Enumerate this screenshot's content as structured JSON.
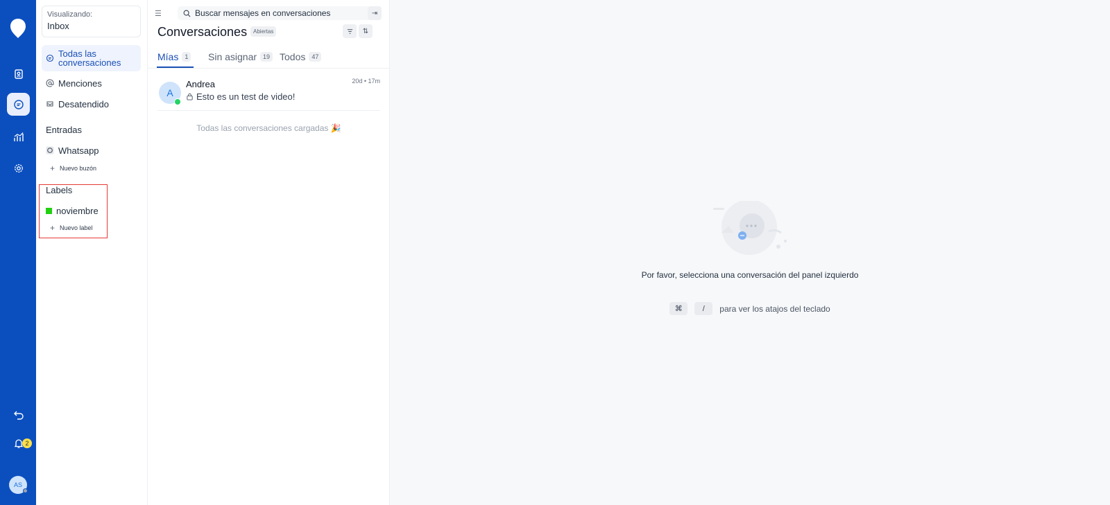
{
  "rail": {
    "nav_items": [
      "contacts",
      "conversations",
      "reports",
      "settings"
    ],
    "notifications_count": "2",
    "user_initials": "AS"
  },
  "sidebar": {
    "viewing_label": "Visualizando:",
    "viewing_value": "Inbox",
    "items": [
      {
        "label": "Todas las conversaciones",
        "icon": "chat-icon",
        "active": true
      },
      {
        "label": "Menciones",
        "icon": "at-icon"
      },
      {
        "label": "Desatendido",
        "icon": "unattended-icon"
      }
    ],
    "inboxes_title": "Entradas",
    "inboxes": [
      {
        "label": "Whatsapp",
        "icon": "whatsapp-icon"
      }
    ],
    "new_inbox": "Nuevo buzón",
    "labels_title": "Labels",
    "labels": [
      {
        "label": "noviembre",
        "color": "#22d011"
      }
    ],
    "new_label": "Nuevo label"
  },
  "list": {
    "search_placeholder": "Buscar mensajes en conversaciones",
    "title": "Conversaciones",
    "status": "Abiertas",
    "tabs": [
      {
        "label": "Mías",
        "count": "1",
        "active": true
      },
      {
        "label": "Sin asignar",
        "count": "19"
      },
      {
        "label": "Todos",
        "count": "47"
      }
    ],
    "conversations": [
      {
        "initial": "A",
        "name": "Andrea",
        "time": "20d • 17m",
        "message": "Esto es un test de video!"
      }
    ],
    "loaded_text": "Todas las conversaciones cargadas 🎉"
  },
  "detail": {
    "empty_message": "Por favor, selecciona una conversación del panel izquierdo",
    "shortcut_keys": [
      "⌘",
      "/"
    ],
    "shortcut_text": "para ver los atajos del teclado"
  },
  "colors": {
    "rail": "#0b4fbf",
    "accent": "#1a4fb5",
    "label_green": "#22d011",
    "highlight": "#e53935"
  }
}
